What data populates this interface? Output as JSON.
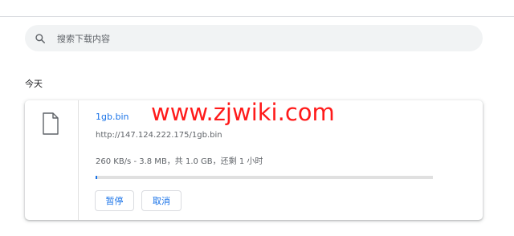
{
  "search": {
    "placeholder": "搜索下载内容",
    "icon": "search-icon"
  },
  "date_group": "今天",
  "download": {
    "file_name": "1gb.bin",
    "url": "http://147.124.222.175/1gb.bin",
    "status": "260 KB/s - 3.8 MB，共 1.0 GB，还剩 1 小时",
    "progress_fraction": 0.0037,
    "icon": "file-icon",
    "pause_label": "暂停",
    "cancel_label": "取消"
  },
  "watermark": "www.zjwiki.com",
  "colors": {
    "accent": "#1a73e8",
    "watermark": "#ff1a1a",
    "search_bg": "#f1f3f4"
  }
}
